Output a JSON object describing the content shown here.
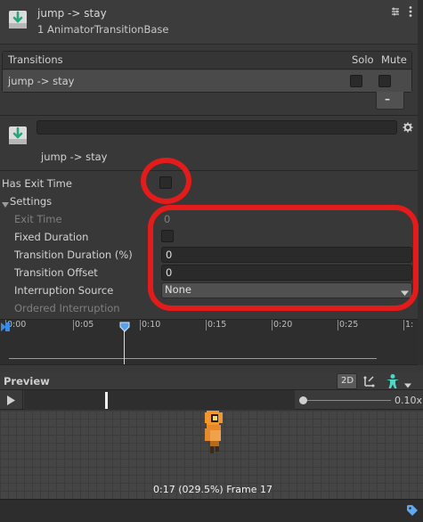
{
  "header": {
    "title": "jump -> stay",
    "subtitle": "1 AnimatorTransitionBase"
  },
  "transitions": {
    "header": "Transitions",
    "solo_label": "Solo",
    "mute_label": "Mute",
    "rows": [
      {
        "label": "jump -> stay",
        "solo": false,
        "mute": false
      }
    ],
    "remove_label": "–"
  },
  "transition": {
    "name_value": "",
    "title": "jump -> stay",
    "has_exit_time_label": "Has Exit Time",
    "has_exit_time": false,
    "settings_label": "Settings"
  },
  "settings": {
    "exit_time_label": "Exit Time",
    "exit_time_value": "0",
    "fixed_duration_label": "Fixed Duration",
    "fixed_duration": false,
    "transition_duration_label": "Transition Duration (%)",
    "transition_duration_value": "0",
    "transition_offset_label": "Transition Offset",
    "transition_offset_value": "0",
    "interruption_source_label": "Interruption Source",
    "interruption_source_value": "None",
    "ordered_interruption_label": "Ordered Interruption"
  },
  "timeline": {
    "ticks": [
      "0:00",
      "0:05",
      "0:10",
      "0:15",
      "0:20",
      "0:25",
      "1:"
    ]
  },
  "preview": {
    "title": "Preview",
    "mode_label": "2D",
    "speed_label": "0.10x",
    "status": "0:17 (029.5%) Frame 17"
  },
  "colors": {
    "panel_bg": "#383838",
    "highlight_red": "#e31b1b",
    "accent_blue": "#3d8be0",
    "teal": "#4fd6c6"
  }
}
